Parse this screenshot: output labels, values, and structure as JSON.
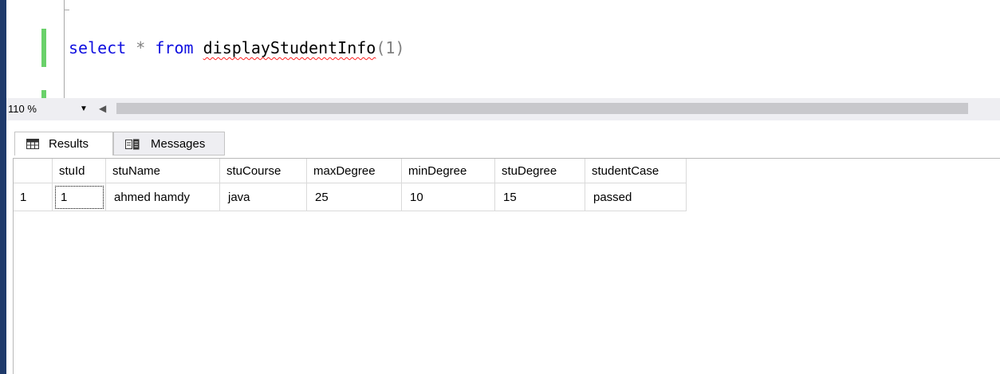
{
  "editor": {
    "code": {
      "kw_select": "select",
      "star": "*",
      "kw_from": "from",
      "func": "displayStudentInfo",
      "args": "(1)"
    }
  },
  "zoom": {
    "value": "110 %"
  },
  "results": {
    "tabs": [
      {
        "label": "Results",
        "icon": "grid-icon"
      },
      {
        "label": "Messages",
        "icon": "messages-icon"
      }
    ],
    "columns": [
      "stuId",
      "stuName",
      "stuCourse",
      "maxDegree",
      "minDegree",
      "stuDegree",
      "studentCase"
    ],
    "rows": [
      {
        "num": "1",
        "cells": [
          "1",
          "ahmed hamdy",
          "java",
          "25",
          "10",
          "15",
          "passed"
        ]
      }
    ]
  },
  "colors": {
    "keyword": "#1010e0",
    "error_squiggle": "#ff2020",
    "change_mark": "#6ad16a",
    "left_strip": "#1f3a6b"
  }
}
